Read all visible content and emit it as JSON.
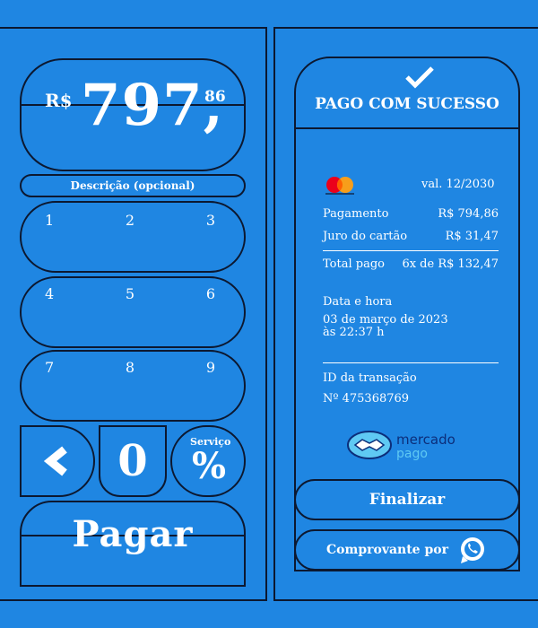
{
  "keypad": {
    "currency": "R$",
    "amount_integer": "797,",
    "amount_decimal": "86",
    "description_placeholder": "Descrição (opcional)",
    "row1": [
      "1",
      "2",
      "3"
    ],
    "row2": [
      "4",
      "5",
      "6"
    ],
    "row3": [
      "7",
      "8",
      "9"
    ],
    "zero": "0",
    "service_label": "Serviço",
    "service_symbol": "%",
    "pay_label": "Pagar"
  },
  "receipt": {
    "success_title": "PAGO COM SUCESSO",
    "card_brand": "mastercard",
    "card_validity": "val. 12/2030",
    "payment_label": "Pagamento",
    "payment_value": "R$ 794,86",
    "fee_label": "Juro do cartão",
    "fee_value": "R$ 31,47",
    "total_label": "Total pago",
    "total_value": "6x de R$ 132,47",
    "date_label": "Data e hora",
    "date_line1": "03 de março de 2023",
    "date_line2": "às 22:37 h",
    "tx_label": "ID da transação",
    "tx_value": "Nº 475368769",
    "brand_line1": "mercado",
    "brand_line2": "pago",
    "finalize_label": "Finalizar",
    "share_label": "Comprovante por"
  },
  "colors": {
    "background": "#1f86e2",
    "outline": "#0c1830",
    "mercadopago_blue": "#0c2e7a",
    "mercadopago_light": "#5fc9f3",
    "whatsapp_icon": "#ffffff"
  },
  "icons": [
    "check-icon",
    "mastercard-logo",
    "handshake-icon",
    "back-arrow-icon",
    "whatsapp-icon"
  ]
}
